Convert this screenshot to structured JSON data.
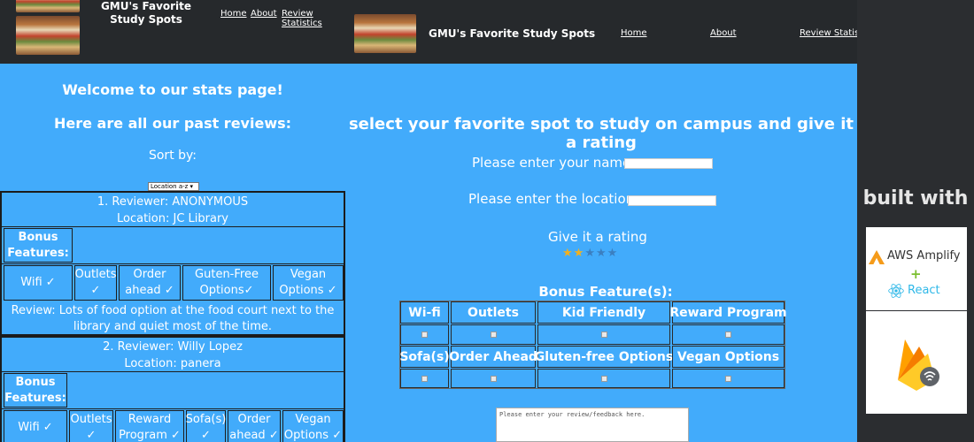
{
  "left": {
    "brand": "GMU's Favorite Study Spots",
    "nav": [
      "Home",
      "About",
      "Review Statistics"
    ],
    "welcome": "Welcome to our stats page!",
    "past_reviews": "Here are all our past reviews:",
    "sort_by": "Sort by:",
    "sort_value": "Location a-z ▾",
    "reviews": [
      {
        "reviewer": "1. Reviewer: ANONYMOUS",
        "location": "Location: JC Library",
        "bonus_label": "Bonus Features:",
        "features": [
          "Wifi ✓",
          "Outlets ✓",
          "Order ahead ✓",
          "Guten-Free Options✓",
          "Vegan Options ✓"
        ],
        "review": "Review: Lots of food option at the food court next to the library and quiet most of the time."
      },
      {
        "reviewer": "2. Reviewer: Willy Lopez",
        "location": "Location: panera",
        "bonus_label": "Bonus Features:",
        "features": [
          "Wifi ✓",
          "Outlets ✓",
          "Reward Program ✓",
          "Sofa(s) ✓",
          "Order ahead ✓",
          "Vegan Options ✓"
        ]
      }
    ]
  },
  "mid": {
    "brand": "GMU's Favorite Study Spots",
    "nav": [
      "Home",
      "About",
      "Review Statistics"
    ],
    "title": "select your favorite spot to study on campus and give it a rating",
    "name_label": "Please enter your name:",
    "name_value": "",
    "location_label": "Please enter the location:",
    "location_value": "",
    "rating_label": "Give it a rating",
    "rating": 2,
    "rating_max": 5,
    "bonus_label": "Bonus Feature(s):",
    "features_row1": [
      "Wi-fi",
      "Outlets",
      "Kid Friendly",
      "Reward Program"
    ],
    "features_row2": [
      "Sofa(s)",
      "Order Ahead",
      "Gluten-free Options",
      "Vegan Options"
    ],
    "review_placeholder": "Please enter your review/feedback here."
  },
  "right": {
    "built_with": "built with",
    "aws": "AWS Amplify",
    "react": "React"
  },
  "colors": {
    "panel_bg": "#42abfb",
    "nav_bg": "#26292c",
    "star_on": "#f2b01e",
    "star_off": "#3b7fc0",
    "aws_orange": "#f59b1a",
    "react_blue": "#2fb8e8"
  },
  "icons": [
    "books-logo",
    "aws-amplify-logo",
    "react-logo",
    "firebase-logo",
    "checkbox-icon",
    "star-icon"
  ]
}
